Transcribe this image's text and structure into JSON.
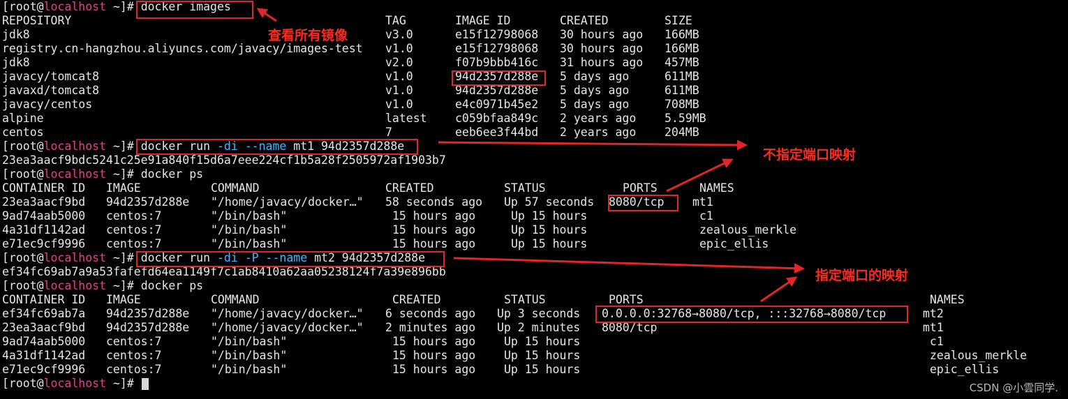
{
  "terminal": {
    "prompt": {
      "open": "[root@",
      "host": "localhost",
      "close": " ~]# "
    },
    "commands": {
      "images": "docker images",
      "run_mt1": {
        "base": "docker run ",
        "flag1": "-di",
        "flag2": "--name",
        "rest": " mt1 94d2357d288e"
      },
      "ps": "docker ps",
      "run_mt2": {
        "base": "docker run ",
        "flag1": "-di",
        "flag2": "-P",
        "flag3": "--name",
        "rest": " mt2 94d2357d288e"
      }
    },
    "images_table": {
      "headers": [
        "REPOSITORY",
        "TAG",
        "IMAGE ID",
        "CREATED",
        "SIZE"
      ],
      "rows": [
        [
          "jdk8",
          "v3.0",
          "e15f12798068",
          "30 hours ago",
          "166MB"
        ],
        [
          "registry.cn-hangzhou.aliyuncs.com/javacy/images-test",
          "v1.0",
          "e15f12798068",
          "30 hours ago",
          "166MB"
        ],
        [
          "jdk8",
          "v2.0",
          "f07b9bbb416c",
          "31 hours ago",
          "457MB"
        ],
        [
          "javacy/tomcat8",
          "v1.0",
          "94d2357d288e",
          "5 days ago",
          "611MB"
        ],
        [
          "javaxd/tomcat8",
          "v1.0",
          "94d2357d288e",
          "5 days ago",
          "611MB"
        ],
        [
          "javacy/centos",
          "v1.0",
          "e4c0971b45e2",
          "5 days ago",
          "708MB"
        ],
        [
          "alpine",
          "latest",
          "c059bfaa849c",
          "2 years ago",
          "5.59MB"
        ],
        [
          "centos",
          "7",
          "eeb6ee3f44bd",
          "2 years ago",
          "204MB"
        ]
      ]
    },
    "mt1_container_id": "23ea3aacf9bdc5241c25e91a840f15d6a7eee224cf1b5a28f2505972af1903b7",
    "mt2_container_id": "ef34fc69ab7a9a53fafefd64ea1149f7c1ab8410a62aa05238124f7a39e896bb",
    "ps_headers": [
      "CONTAINER ID",
      "IMAGE",
      "COMMAND",
      "CREATED",
      "STATUS",
      "PORTS",
      "NAMES"
    ],
    "ps1_rows": [
      [
        "23ea3aacf9bd",
        "94d2357d288e",
        "\"/home/javacy/docker…\"",
        "58 seconds ago",
        "Up 57 seconds",
        "8080/tcp",
        "mt1"
      ],
      [
        "9ad74aab5000",
        "centos:7",
        "\"/bin/bash\"",
        "15 hours ago",
        "Up 15 hours",
        "",
        "c1"
      ],
      [
        "4a31df1142ad",
        "centos:7",
        "\"/bin/bash\"",
        "15 hours ago",
        "Up 15 hours",
        "",
        "zealous_merkle"
      ],
      [
        "e71ec9cf9996",
        "centos:7",
        "\"/bin/bash\"",
        "15 hours ago",
        "Up 15 hours",
        "",
        "epic_ellis"
      ]
    ],
    "ps2_rows": [
      [
        "ef34fc69ab7a",
        "94d2357d288e",
        "\"/home/javacy/docker…\"",
        "6 seconds ago",
        "Up 3 seconds",
        "0.0.0.0:32768→8080/tcp, :::32768→8080/tcp",
        "mt2"
      ],
      [
        "23ea3aacf9bd",
        "94d2357d288e",
        "\"/home/javacy/docker…\"",
        "2 minutes ago",
        "Up 2 minutes",
        "8080/tcp",
        "mt1"
      ],
      [
        "9ad74aab5000",
        "centos:7",
        "\"/bin/bash\"",
        "15 hours ago",
        "Up 15 hours",
        "",
        "c1"
      ],
      [
        "4a31df1142ad",
        "centos:7",
        "\"/bin/bash\"",
        "15 hours ago",
        "Up 15 hours",
        "",
        "zealous_merkle"
      ],
      [
        "e71ec9cf9996",
        "centos:7",
        "\"/bin/bash\"",
        "15 hours ago",
        "Up 15 hours",
        "",
        "epic_ellis"
      ]
    ]
  },
  "annotations": {
    "view_all_images": "查看所有镜像",
    "no_port_mapping": "不指定端口映射",
    "port_mapping": "指定端口的映射",
    "color": "#ff2a1e"
  },
  "watermark": "CSDN @小雲同学.",
  "colors": {
    "background": "#000000",
    "text": "#e6e6e6",
    "user": "#e0408c",
    "flag": "#3fb8ff",
    "box": "#e0262a"
  },
  "cursor_icon": "block-cursor-icon"
}
